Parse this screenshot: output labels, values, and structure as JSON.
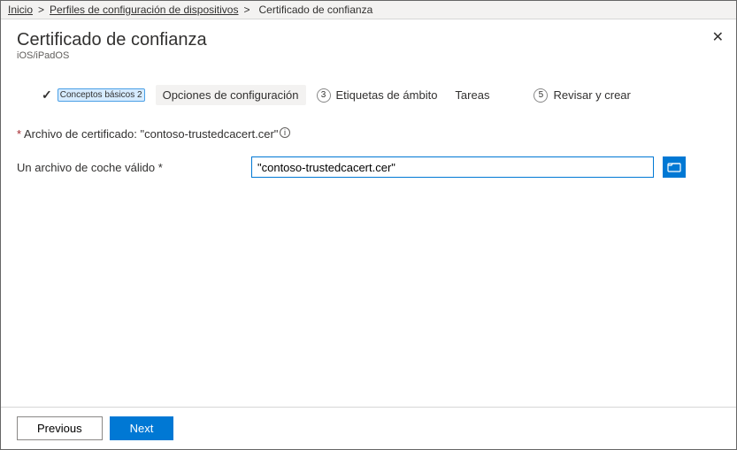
{
  "breadcrumb": {
    "items": [
      {
        "label": "Inicio"
      },
      {
        "label": "Perfiles de configuración de dispositivos"
      }
    ],
    "sep": "&gt;",
    "current": "Certificado de confianza"
  },
  "header": {
    "title": "Certificado de confianza",
    "subtitle": "iOS/iPadOS"
  },
  "wizard": {
    "steps": [
      {
        "label": "Conceptos básicos 2",
        "state": "done"
      },
      {
        "label": "Opciones de configuración",
        "state": "active"
      },
      {
        "num": "3",
        "label": "Etiquetas de ámbito",
        "state": "pending"
      },
      {
        "label": "Tareas",
        "state": "pending"
      },
      {
        "num": "5",
        "label": "Revisar y crear",
        "state": "pending"
      }
    ]
  },
  "form": {
    "cert_label_prefix": "Archivo de certificado: ",
    "cert_filename": "\"contoso-trustedcacert.cer\"",
    "field_label": "Un archivo de coche válido *",
    "field_value": "\"contoso-trustedcacert.cer\""
  },
  "footer": {
    "prev": "Previous",
    "next": "Next"
  }
}
